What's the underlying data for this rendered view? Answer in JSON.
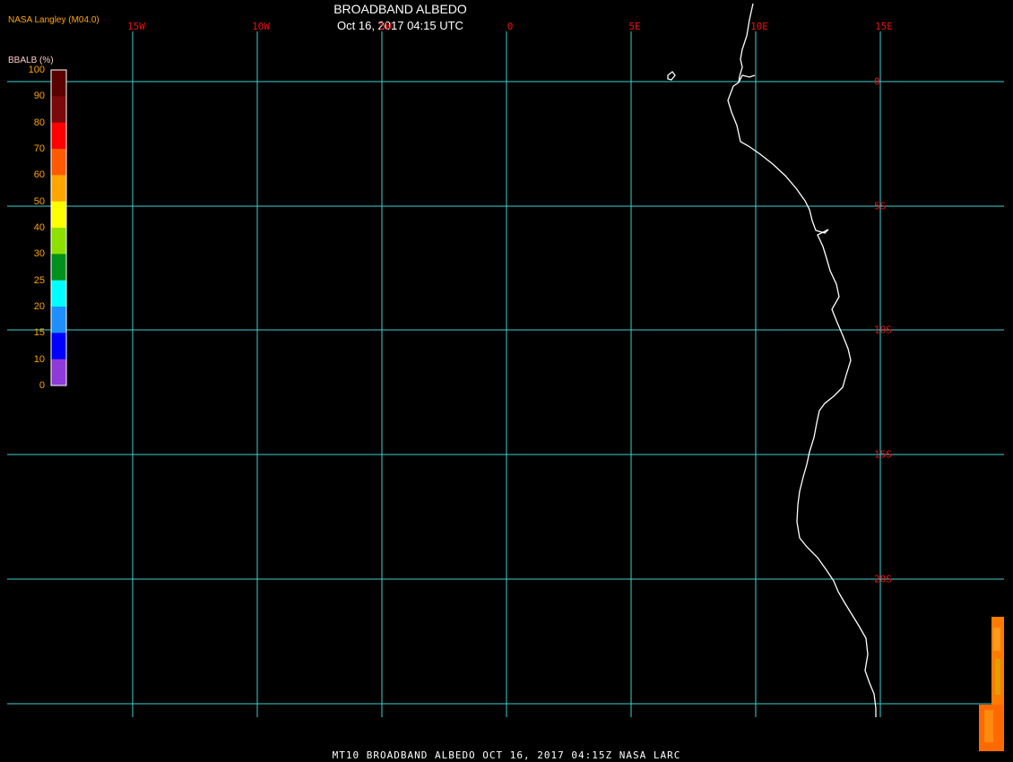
{
  "header": {
    "title": "BROADBAND ALBEDO",
    "subtitle": "Oct 16, 2017 04:15 UTC",
    "source": "NASA Langley (M04.0)"
  },
  "colorbar": {
    "label": "BBALB (%)",
    "ticks": [
      "100",
      "90",
      "80",
      "70",
      "60",
      "50",
      "40",
      "30",
      "25",
      "20",
      "15",
      "10",
      "0"
    ],
    "colors": [
      "#5a0000",
      "#7a0a0a",
      "#ff0000",
      "#ff5a00",
      "#ffa500",
      "#ffff00",
      "#8ee000",
      "#00901e",
      "#00ffff",
      "#1e8fff",
      "#0000ff",
      "#8e3ad8"
    ]
  },
  "map": {
    "longitude_labels": [
      "15W",
      "10W",
      "5W",
      "0",
      "5E",
      "10E",
      "15E"
    ],
    "latitude_labels": [
      "0",
      "5S",
      "10S",
      "15S",
      "20S"
    ],
    "coastline_color": "#ffffff",
    "grid_color": "#40d0d0",
    "label_color": "#e11111"
  },
  "footer": {
    "text": "MT10  BROADBAND ALBEDO   OCT 16, 2017 04:15Z   NASA LARC"
  },
  "colors": {
    "background": "#000000",
    "text": "#ffffff",
    "accent": "#ffa500"
  }
}
